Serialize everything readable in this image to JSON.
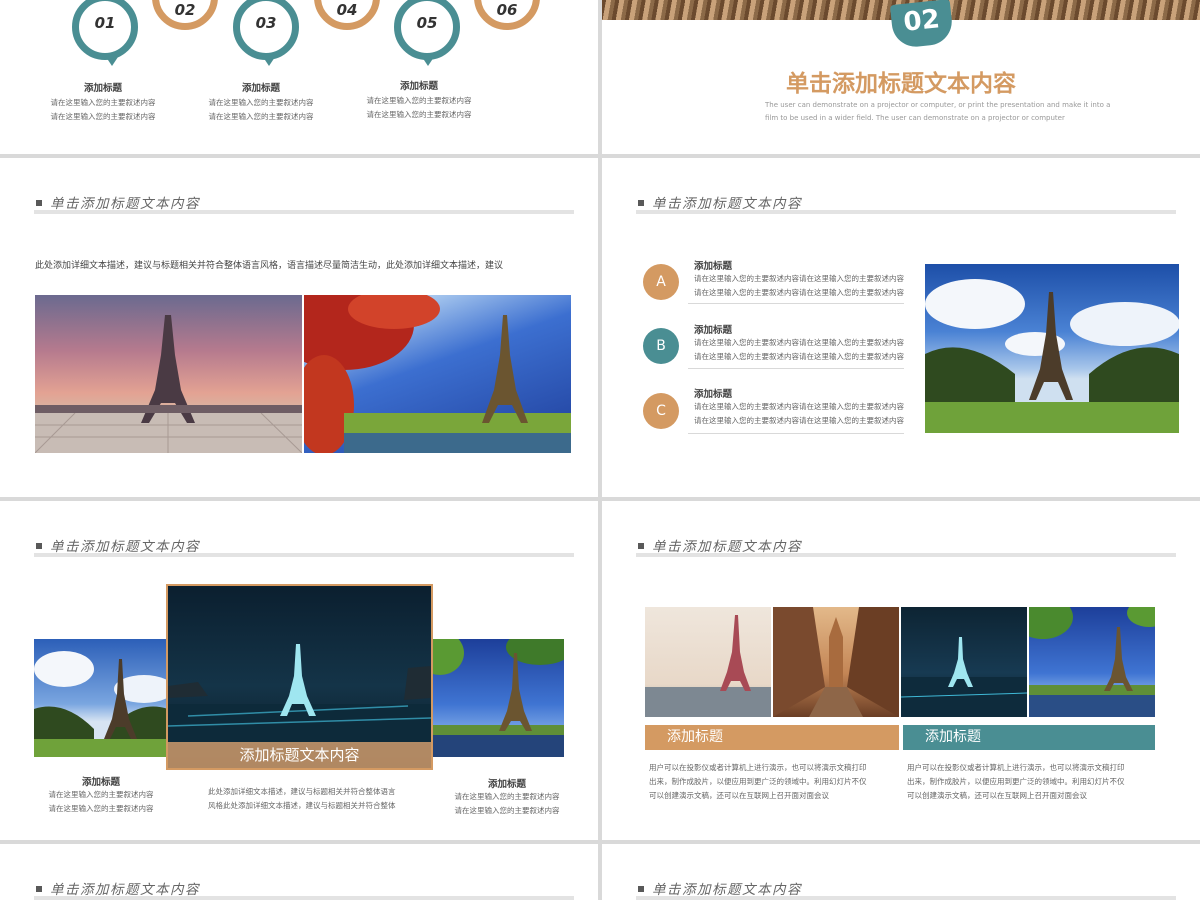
{
  "colors": {
    "teal": "#4a8e93",
    "tan": "#d49a62"
  },
  "slide1": {
    "pins": [
      {
        "num": "01",
        "color": "#4a8e93",
        "label": "添加标题",
        "line1": "请在这里输入您的主要叙述内容",
        "line2": "请在这里输入您的主要叙述内容"
      },
      {
        "num": "02",
        "color": "#d49a62"
      },
      {
        "num": "03",
        "color": "#4a8e93",
        "label": "添加标题",
        "line1": "请在这里输入您的主要叙述内容",
        "line2": "请在这里输入您的主要叙述内容"
      },
      {
        "num": "04",
        "color": "#d49a62"
      },
      {
        "num": "05",
        "color": "#4a8e93",
        "label": "添加标题",
        "line1": "请在这里输入您的主要叙述内容",
        "line2": "请在这里输入您的主要叙述内容"
      },
      {
        "num": "06",
        "color": "#d49a62"
      }
    ]
  },
  "slide2": {
    "badge": "02",
    "title": "单击添加标题文本内容",
    "desc1": "The user can demonstrate on a projector or computer, or print the presentation and make it into a",
    "desc2": "film to be used in a wider field. The user can demonstrate on a projector or computer"
  },
  "header_title": "单击添加标题文本内容",
  "slide3": {
    "text": "此处添加详细文本描述，建议与标题相关并符合整体语言风格，语言描述尽量简洁生动，此处添加详细文本描述，建议"
  },
  "slide4": {
    "items": [
      {
        "badge": "A",
        "color": "#d49a62",
        "label": "添加标题",
        "line1": "请在这里输入您的主要叙述内容请在这里输入您的主要叙述内容",
        "line2": "请在这里输入您的主要叙述内容请在这里输入您的主要叙述内容"
      },
      {
        "badge": "B",
        "color": "#4a8e93",
        "label": "添加标题",
        "line1": "请在这里输入您的主要叙述内容请在这里输入您的主要叙述内容",
        "line2": "请在这里输入您的主要叙述内容请在这里输入您的主要叙述内容"
      },
      {
        "badge": "C",
        "color": "#d49a62",
        "label": "添加标题",
        "line1": "请在这里输入您的主要叙述内容请在这里输入您的主要叙述内容",
        "line2": "请在这里输入您的主要叙述内容请在这里输入您的主要叙述内容"
      }
    ]
  },
  "slide5": {
    "caption": "添加标题文本内容",
    "left": {
      "label": "添加标题",
      "line1": "请在这里输入您的主要叙述内容",
      "line2": "请在这里输入您的主要叙述内容"
    },
    "center": {
      "line1": "此处添加详细文本描述，建议与标题相关并符合整体语言",
      "line2": "风格此处添加详细文本描述，建议与标题相关并符合整体"
    },
    "right": {
      "label": "添加标题",
      "line1": "请在这里输入您的主要叙述内容",
      "line2": "请在这里输入您的主要叙述内容"
    }
  },
  "slide6": {
    "bar1": "添加标题",
    "bar2": "添加标题",
    "col1": {
      "line1": "用户可以在投影仪或者计算机上进行演示，也可以将演示文稿打印",
      "line2": "出来，制作成胶片，以便应用到更广泛的领域中。利用幻灯片不仅",
      "line3": "可以创建演示文稿，还可以在互联网上召开面对面会议"
    },
    "col2": {
      "line1": "用户可以在投影仪或者计算机上进行演示，也可以将演示文稿打印",
      "line2": "出来，制作成胶片，以便应用到更广泛的领域中。利用幻灯片不仅",
      "line3": "可以创建演示文稿，还可以在互联网上召开面对面会议"
    }
  }
}
